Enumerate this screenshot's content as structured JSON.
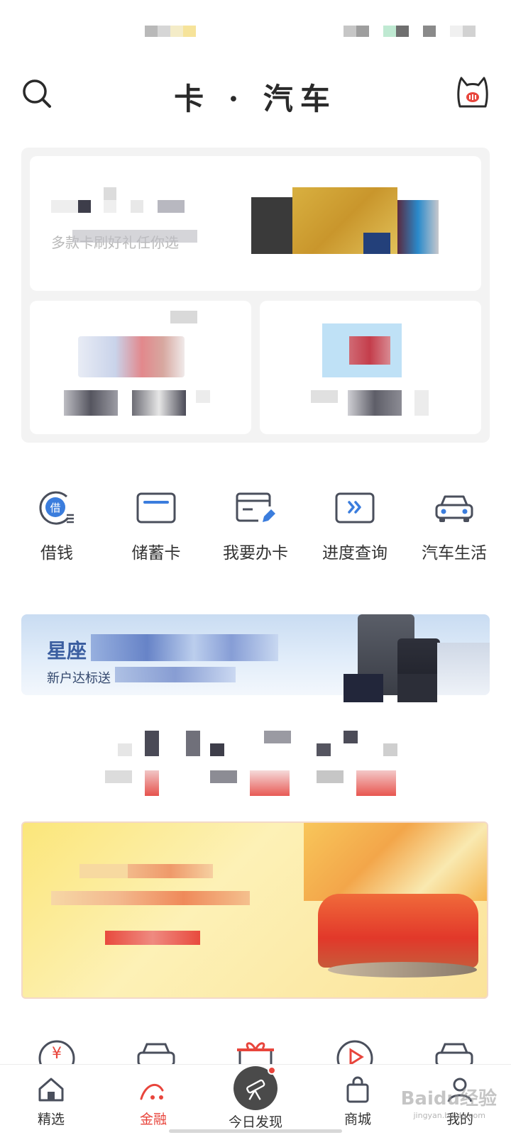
{
  "header": {
    "title": "卡 · 汽车",
    "search_icon": "search-icon",
    "mascot_icon": "cat-mascot-icon"
  },
  "promo": {
    "top_subtitle": "多款卡刷好礼任你选"
  },
  "quick_actions": [
    {
      "label": "借钱",
      "icon": "borrow-icon"
    },
    {
      "label": "储蓄卡",
      "icon": "debit-card-icon"
    },
    {
      "label": "我要办卡",
      "icon": "apply-card-icon"
    },
    {
      "label": "进度查询",
      "icon": "progress-query-icon"
    },
    {
      "label": "汽车生活",
      "icon": "car-life-icon"
    }
  ],
  "star_banner": {
    "title": "星座",
    "subtitle": "新户达标送"
  },
  "bottom_nav": [
    {
      "label": "精选",
      "icon": "home-icon",
      "active": false
    },
    {
      "label": "金融",
      "icon": "finance-icon",
      "active": true
    },
    {
      "label": "今日发现",
      "icon": "telescope-icon",
      "active": false
    },
    {
      "label": "商城",
      "icon": "shopping-bag-icon",
      "active": false
    },
    {
      "label": "我的",
      "icon": "profile-icon",
      "active": false
    }
  ],
  "watermark": {
    "brand": "Baidu经验",
    "url": "jingyan.baidu.com"
  },
  "colors": {
    "accent": "#e8453c",
    "icon_blue": "#3b7ddd",
    "icon_dark": "#4a4f5c"
  }
}
